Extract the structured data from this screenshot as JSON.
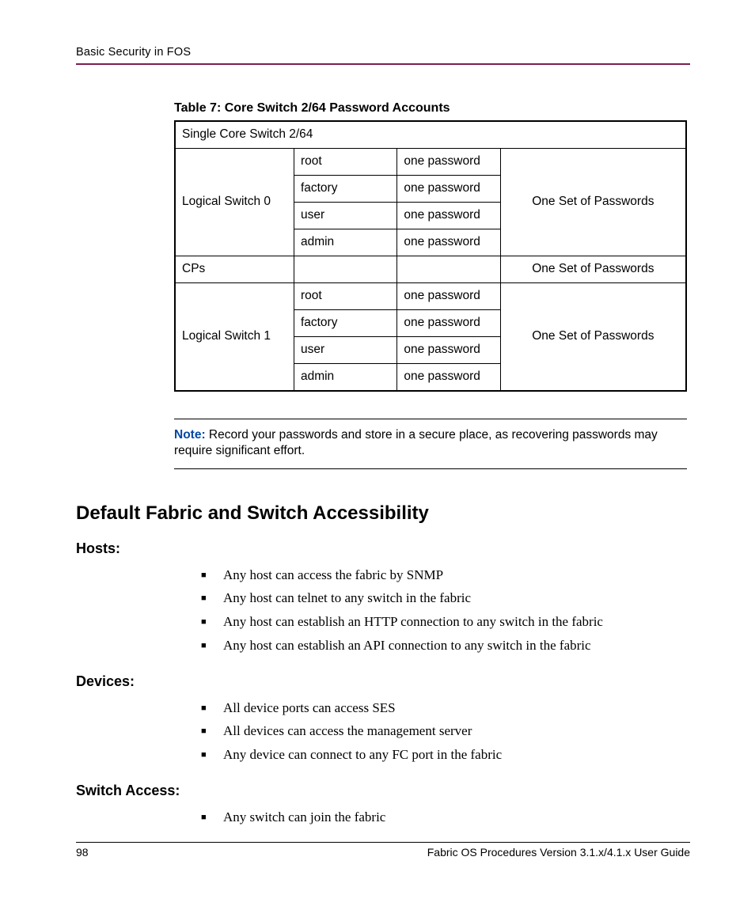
{
  "header": {
    "left": "Basic Security in FOS"
  },
  "table": {
    "caption": "Table 7:  Core Switch 2/64 Password Accounts",
    "r1c1": "Single Core Switch 2/64",
    "ls0": "Logical Switch 0",
    "ls1": "Logical Switch 1",
    "cps": "CPs",
    "root": "root",
    "factory": "factory",
    "user": "user",
    "admin": "admin",
    "onepw": "one password",
    "oneset": "One Set of Passwords"
  },
  "note": {
    "label": "Note:",
    "text": "  Record your passwords and store in a secure place, as recovering passwords may require significant effort."
  },
  "section": {
    "title": "Default Fabric and Switch Accessibility",
    "hosts": {
      "title": "Hosts:",
      "b1": "Any host can access the fabric by SNMP",
      "b2": "Any host can telnet to any switch in the fabric",
      "b3": "Any host can establish an HTTP connection to any switch in the fabric",
      "b4": "Any host can establish an API connection to any switch in the fabric"
    },
    "devices": {
      "title": "Devices:",
      "b1": "All device ports can access SES",
      "b2": "All devices can access the management server",
      "b3": "Any device can connect to any FC port in the fabric"
    },
    "switch": {
      "title": "Switch Access:",
      "b1": "Any switch can join the fabric"
    }
  },
  "footer": {
    "page": "98",
    "right": "Fabric OS Procedures Version 3.1.x/4.1.x User Guide"
  }
}
